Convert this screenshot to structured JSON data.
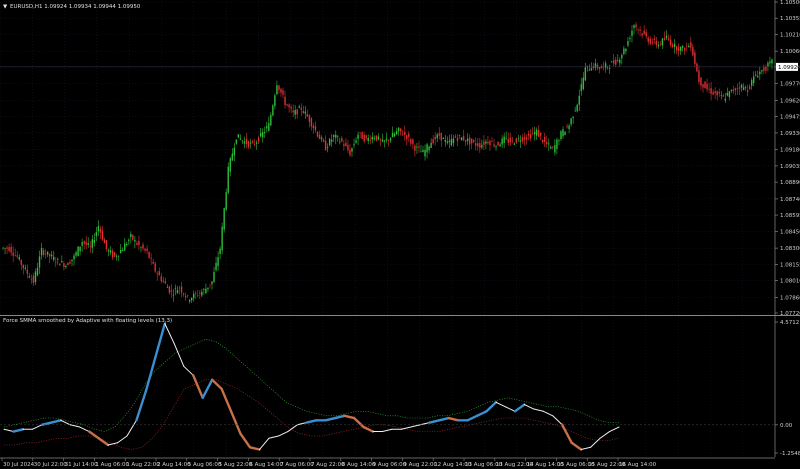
{
  "window": {
    "main_title": "EURUSD,H1  1.09924 1.09934 1.09944 1.09950",
    "indicator_title": "Force SMMA smoothed by Adaptive with floating levels (13,3)"
  },
  "colors": {
    "background": "#000000",
    "grid": "#1a1a2e",
    "bull": "#2fbf3a",
    "bear": "#e03030",
    "current_price_line": "#3a3a55",
    "force_up": "#3a8fd0",
    "force_down": "#c87048",
    "force_neutral": "#f0f0f0",
    "upper_level": "#2fbf3a",
    "lower_level": "#c03030",
    "zero_line": "#444444"
  },
  "chart_data": [
    {
      "type": "candlestick",
      "price_axis_labels": [
        "1.10500",
        "1.10355",
        "1.10210",
        "1.10060",
        "1.09920",
        "1.09770",
        "1.09620",
        "1.09475",
        "1.09330",
        "1.09180",
        "1.09035",
        "1.08890",
        "1.08740",
        "1.08595",
        "1.08450",
        "1.08300",
        "1.08155",
        "1.08010",
        "1.07860",
        "1.07720"
      ],
      "current_price": "1.09920",
      "ylim": [
        1.0772,
        1.105
      ],
      "close_path": [
        1.083,
        1.0822,
        1.081,
        1.08,
        1.0828,
        1.0823,
        1.0818,
        1.0815,
        1.0822,
        1.0836,
        1.083,
        1.085,
        1.0829,
        1.0822,
        1.083,
        1.084,
        1.0832,
        1.0826,
        1.081,
        1.08,
        1.079,
        1.0795,
        1.0785,
        1.0788,
        1.0792,
        1.08,
        1.083,
        1.09,
        1.093,
        1.0925,
        1.0922,
        1.093,
        1.094,
        1.0978,
        1.096,
        1.095,
        1.0955,
        1.0945,
        1.0932,
        1.092,
        1.093,
        1.0925,
        1.0915,
        1.0932,
        1.0927,
        1.093,
        1.0924,
        1.0929,
        1.0935,
        1.093,
        1.092,
        1.0915,
        1.0925,
        1.0931,
        1.0923,
        1.0929,
        1.0928,
        1.0924,
        1.0922,
        1.0926,
        1.0922,
        1.0927,
        1.0925,
        1.0928,
        1.093,
        1.0934,
        1.0924,
        1.0918,
        1.0932,
        1.094,
        1.096,
        1.099,
        1.0993,
        1.0991,
        1.0994,
        1.0998,
        1.101,
        1.103,
        1.1022,
        1.1015,
        1.1012,
        1.1018,
        1.101,
        1.1008,
        1.1012,
        1.098,
        1.0972,
        1.0968,
        1.0964,
        1.097,
        1.0975,
        1.0972,
        1.0985,
        1.099,
        1.0996
      ]
    },
    {
      "type": "line",
      "title": "Force SMMA smoothed by Adaptive with floating levels (13,3)",
      "y_axis_labels": [
        "4.5712",
        "0.00",
        "-1.2548"
      ],
      "ylim": [
        -1.2548,
        4.5712
      ],
      "x_tick_labels": [
        "30 Jul 2024",
        "30 Jul 22:00",
        "31 Jul 14:00",
        "1 Aug 06:00",
        "1 Aug 22:00",
        "2 Aug 14:00",
        "5 Aug 06:00",
        "5 Aug 22:00",
        "6 Aug 14:00",
        "7 Aug 06:00",
        "7 Aug 22:00",
        "8 Aug 14:00",
        "9 Aug 06:00",
        "9 Aug 22:00",
        "12 Aug 14:00",
        "13 Aug 06:00",
        "13 Aug 22:00",
        "14 Aug 14:00",
        "15 Aug 06:00",
        "15 Aug 22:00",
        "16 Aug 14:00"
      ],
      "force": [
        -0.2,
        -0.3,
        -0.2,
        -0.2,
        0.0,
        0.1,
        0.2,
        0.0,
        -0.1,
        -0.3,
        -0.6,
        -0.9,
        -0.8,
        -0.5,
        0.2,
        1.5,
        3.0,
        4.5,
        3.6,
        2.6,
        2.2,
        1.2,
        2.0,
        1.6,
        0.6,
        -0.4,
        -1.0,
        -1.1,
        -0.6,
        -0.5,
        -0.3,
        0.0,
        0.1,
        0.2,
        0.2,
        0.3,
        0.4,
        0.3,
        -0.1,
        -0.3,
        -0.3,
        -0.2,
        -0.2,
        -0.1,
        0.0,
        0.1,
        0.2,
        0.3,
        0.2,
        0.2,
        0.4,
        0.6,
        1.0,
        0.8,
        0.6,
        0.9,
        0.7,
        0.6,
        0.4,
        0.0,
        -0.8,
        -1.1,
        -1.0,
        -0.6,
        -0.3,
        -0.1
      ],
      "upper_level": [
        -0.1,
        0.0,
        0.1,
        0.2,
        0.3,
        0.3,
        0.2,
        0.1,
        0.0,
        -0.2,
        -0.3,
        -0.1,
        0.4,
        1.0,
        1.8,
        2.4,
        2.8,
        3.2,
        3.4,
        3.6,
        3.8,
        3.7,
        3.4,
        3.0,
        2.6,
        2.2,
        1.8,
        1.4,
        1.0,
        0.8,
        0.6,
        0.5,
        0.4,
        0.4,
        0.5,
        0.6,
        0.6,
        0.5,
        0.4,
        0.4,
        0.3,
        0.3,
        0.3,
        0.4,
        0.4,
        0.5,
        0.6,
        0.8,
        1.0,
        1.1,
        1.2,
        1.1,
        1.0,
        0.9,
        0.8,
        0.8,
        0.7,
        0.6,
        0.4,
        0.2,
        0.1,
        0.1
      ],
      "lower_level": [
        -0.9,
        -0.9,
        -0.8,
        -0.8,
        -0.7,
        -0.6,
        -0.6,
        -0.5,
        -0.5,
        -0.6,
        -0.8,
        -1.0,
        -1.1,
        -1.0,
        -0.6,
        0.0,
        0.8,
        1.6,
        1.8,
        2.0,
        2.0,
        1.8,
        1.6,
        1.3,
        1.0,
        0.6,
        0.2,
        -0.2,
        -0.4,
        -0.5,
        -0.5,
        -0.4,
        -0.3,
        -0.2,
        -0.1,
        0.0,
        0.0,
        -0.1,
        -0.2,
        -0.3,
        -0.3,
        -0.3,
        -0.2,
        -0.1,
        0.0,
        0.1,
        0.2,
        0.3,
        0.3,
        0.3,
        0.2,
        0.1,
        0.0,
        -0.2,
        -0.4,
        -0.6,
        -0.7,
        -0.7,
        -0.6
      ]
    }
  ]
}
